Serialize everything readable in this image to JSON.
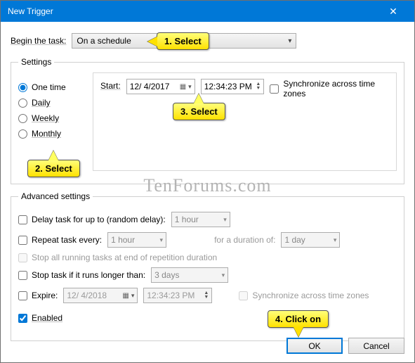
{
  "window": {
    "title": "New Trigger"
  },
  "begin": {
    "label": "Begin the task:",
    "value": "On a schedule"
  },
  "settings": {
    "legend": "Settings",
    "recur": [
      {
        "label": "One time",
        "checked": true
      },
      {
        "label": "Daily",
        "checked": false
      },
      {
        "label": "Weekly",
        "checked": false
      },
      {
        "label": "Monthly",
        "checked": false
      }
    ],
    "start_label": "Start:",
    "start_date": "12/ 4/2017",
    "start_time": "12:34:23 PM",
    "sync_label": "Synchronize across time zones"
  },
  "advanced": {
    "legend": "Advanced settings",
    "delay_label": "Delay task for up to (random delay):",
    "delay_value": "1 hour",
    "repeat_label": "Repeat task every:",
    "repeat_value": "1 hour",
    "duration_label": "for a duration of:",
    "duration_value": "1 day",
    "stop_running_label": "Stop all running tasks at end of repetition duration",
    "stop_if_label": "Stop task if it runs longer than:",
    "stop_if_value": "3 days",
    "expire_label": "Expire:",
    "expire_date": "12/ 4/2018",
    "expire_time": "12:34:23 PM",
    "sync_label": "Synchronize across time zones",
    "enabled_label": "Enabled"
  },
  "buttons": {
    "ok": "OK",
    "cancel": "Cancel"
  },
  "callouts": {
    "c1": "1. Select",
    "c2": "2. Select",
    "c3": "3. Select",
    "c4": "4. Click on"
  },
  "watermark": "TenForums.com"
}
